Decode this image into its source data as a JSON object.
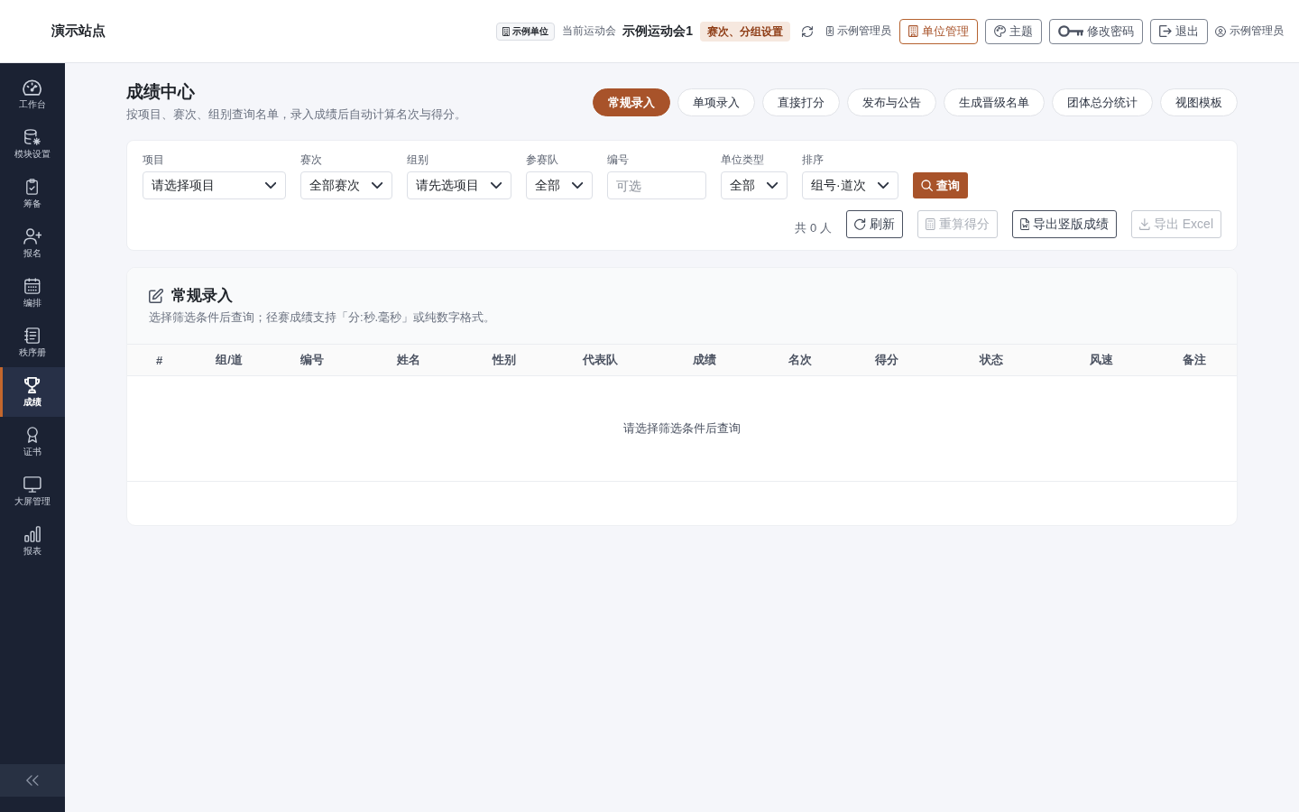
{
  "header": {
    "site_title": "演示站点",
    "org_badge": "示例单位",
    "meet_label": "当前运动会",
    "meet_name": "示例运动会1",
    "meet_settings": "赛次、分组设置",
    "role": "示例管理员",
    "buttons": [
      {
        "label": "单位管理",
        "selected": true
      },
      {
        "label": "主题",
        "selected": false
      },
      {
        "label": "修改密码",
        "selected": false
      },
      {
        "label": "退出",
        "selected": false
      }
    ],
    "user": "示例管理员"
  },
  "sidebar": {
    "items": [
      {
        "label": "工作台",
        "selected": false
      },
      {
        "label": "模块设置",
        "selected": false
      },
      {
        "label": "筹备",
        "selected": false
      },
      {
        "label": "报名",
        "selected": false
      },
      {
        "label": "编排",
        "selected": false
      },
      {
        "label": "秩序册",
        "selected": false
      },
      {
        "label": "成绩",
        "selected": true
      },
      {
        "label": "证书",
        "selected": false
      },
      {
        "label": "大屏管理",
        "selected": false
      },
      {
        "label": "报表",
        "selected": false
      }
    ]
  },
  "page": {
    "title": "成绩中心",
    "subtitle": "按项目、赛次、组别查询名单，录入成绩后自动计算名次与得分。"
  },
  "tabs": [
    {
      "label": "常规录入",
      "selected": true
    },
    {
      "label": "单项录入",
      "selected": false
    },
    {
      "label": "直接打分",
      "selected": false
    },
    {
      "label": "发布与公告",
      "selected": false
    },
    {
      "label": "生成晋级名单",
      "selected": false
    },
    {
      "label": "团体总分统计",
      "selected": false
    },
    {
      "label": "视图模板",
      "selected": false
    }
  ],
  "filters": {
    "fields": [
      {
        "kind": "select",
        "label": "项目",
        "value": "请选择项目"
      },
      {
        "kind": "select",
        "label": "赛次",
        "value": "全部赛次"
      },
      {
        "kind": "select",
        "label": "组别",
        "value": "请先选项目"
      },
      {
        "kind": "select",
        "label": "参赛队",
        "value": "全部"
      },
      {
        "kind": "input",
        "label": "编号",
        "placeholder": "可选"
      },
      {
        "kind": "select",
        "label": "单位类型",
        "value": "全部"
      },
      {
        "kind": "select",
        "label": "排序",
        "value": "组号·道次"
      }
    ],
    "search_button": "查询",
    "count": "共 0 人",
    "actions": [
      {
        "label": "刷新",
        "disabled": false
      },
      {
        "label": "重算得分",
        "disabled": true
      },
      {
        "label": "导出竖版成绩",
        "disabled": false
      },
      {
        "label": "导出 Excel",
        "disabled": true
      }
    ]
  },
  "table_card": {
    "title": "常规录入",
    "subtitle": "选择筛选条件后查询；径赛成绩支持「分:秒.毫秒」或纯数字格式。",
    "columns": [
      "#",
      "组/道",
      "编号",
      "姓名",
      "性别",
      "代表队",
      "成绩",
      "名次",
      "得分",
      "状态",
      "风速",
      "备注"
    ],
    "empty_text": "请选择筛选条件后查询"
  }
}
